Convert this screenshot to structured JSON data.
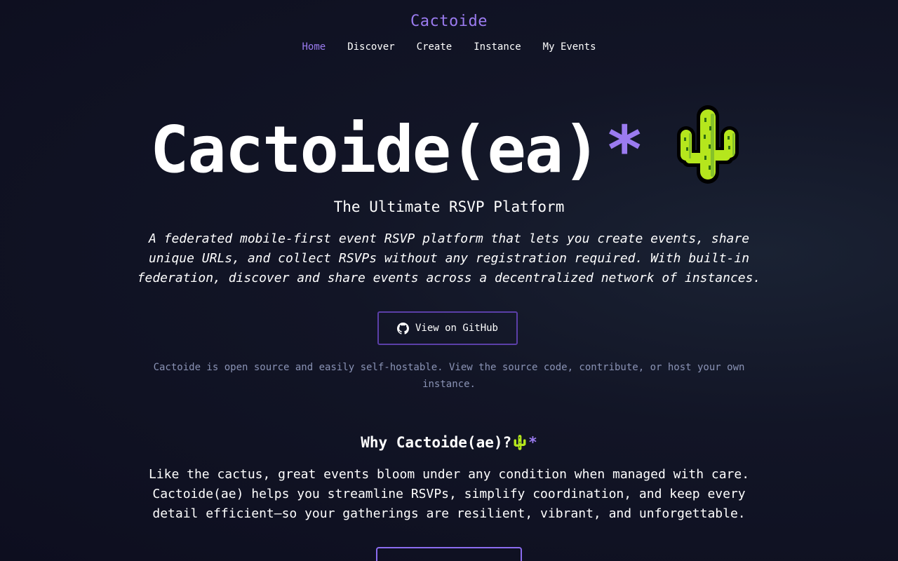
{
  "header": {
    "brand": "Cactoide",
    "nav": [
      {
        "label": "Home",
        "active": true
      },
      {
        "label": "Discover",
        "active": false
      },
      {
        "label": "Create",
        "active": false
      },
      {
        "label": "Instance",
        "active": false
      },
      {
        "label": "My Events",
        "active": false
      }
    ]
  },
  "hero": {
    "title": "Cactoide(ea)",
    "title_asterisk": "*",
    "icon": "cactus-emoji",
    "subtitle": "The Ultimate RSVP Platform",
    "description": "A federated mobile-first event RSVP platform that lets you create events, share unique URLs, and collect RSVPs without any registration required. With built-in federation, discover and share events across a decentralized network of instances."
  },
  "github": {
    "button_label": "View on GitHub",
    "icon": "github-icon",
    "note": "Cactoide is open source and easily self-hostable. View the source code, contribute, or host your own instance."
  },
  "why": {
    "title": "Why Cactoide(ae)?",
    "title_asterisk": "*",
    "icon": "cactus-emoji",
    "description": "Like the cactus, great events bloom under any condition when managed with care. Cactoide(ae) helps you streamline RSVPs, simplify coordination, and keep every detail efficient—so your gatherings are resilient, vibrant, and unforgettable."
  },
  "colors": {
    "accent": "#9b7bf0",
    "background": "#0d0e1f",
    "muted_text": "#8a93b5",
    "button_border": "#5b3fa8"
  }
}
